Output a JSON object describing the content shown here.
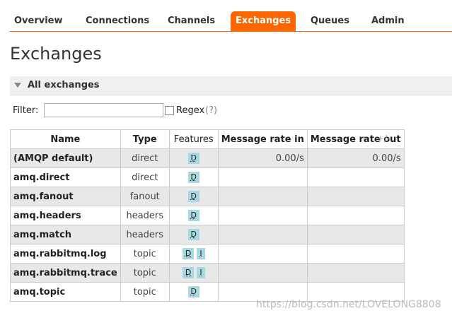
{
  "nav": {
    "tabs": [
      {
        "label": "Overview",
        "name": "tab-overview",
        "active": false
      },
      {
        "label": "Connections",
        "name": "tab-connections",
        "active": false
      },
      {
        "label": "Channels",
        "name": "tab-channels",
        "active": false
      },
      {
        "label": "Exchanges",
        "name": "tab-exchanges",
        "active": true
      },
      {
        "label": "Queues",
        "name": "tab-queues",
        "active": false
      },
      {
        "label": "Admin",
        "name": "tab-admin",
        "active": false
      }
    ],
    "accent_color": "#ff6600"
  },
  "page": {
    "title": "Exchanges"
  },
  "section": {
    "label": "All exchanges",
    "toggle_icon": "triangle-down-icon"
  },
  "filter": {
    "label": "Filter:",
    "value": "",
    "placeholder": "",
    "regex_label": "Regex",
    "regex_checked": false,
    "help": "(?)"
  },
  "table": {
    "columns": [
      "Name",
      "Type",
      "Features",
      "Message rate in",
      "Message rate out"
    ],
    "toggle_columns": "+/-",
    "rows": [
      {
        "name": "(AMQP default)",
        "type": "direct",
        "features": [
          "D"
        ],
        "rate_in": "0.00/s",
        "rate_out": "0.00/s"
      },
      {
        "name": "amq.direct",
        "type": "direct",
        "features": [
          "D"
        ],
        "rate_in": "",
        "rate_out": ""
      },
      {
        "name": "amq.fanout",
        "type": "fanout",
        "features": [
          "D"
        ],
        "rate_in": "",
        "rate_out": ""
      },
      {
        "name": "amq.headers",
        "type": "headers",
        "features": [
          "D"
        ],
        "rate_in": "",
        "rate_out": ""
      },
      {
        "name": "amq.match",
        "type": "headers",
        "features": [
          "D"
        ],
        "rate_in": "",
        "rate_out": ""
      },
      {
        "name": "amq.rabbitmq.log",
        "type": "topic",
        "features": [
          "D",
          "I"
        ],
        "rate_in": "",
        "rate_out": ""
      },
      {
        "name": "amq.rabbitmq.trace",
        "type": "topic",
        "features": [
          "D",
          "I"
        ],
        "rate_in": "",
        "rate_out": ""
      },
      {
        "name": "amq.topic",
        "type": "topic",
        "features": [
          "D"
        ],
        "rate_in": "",
        "rate_out": ""
      }
    ],
    "badge_color": "#a8d8e0"
  },
  "watermark": "https://blog.csdn.net/LOVELONG8808"
}
